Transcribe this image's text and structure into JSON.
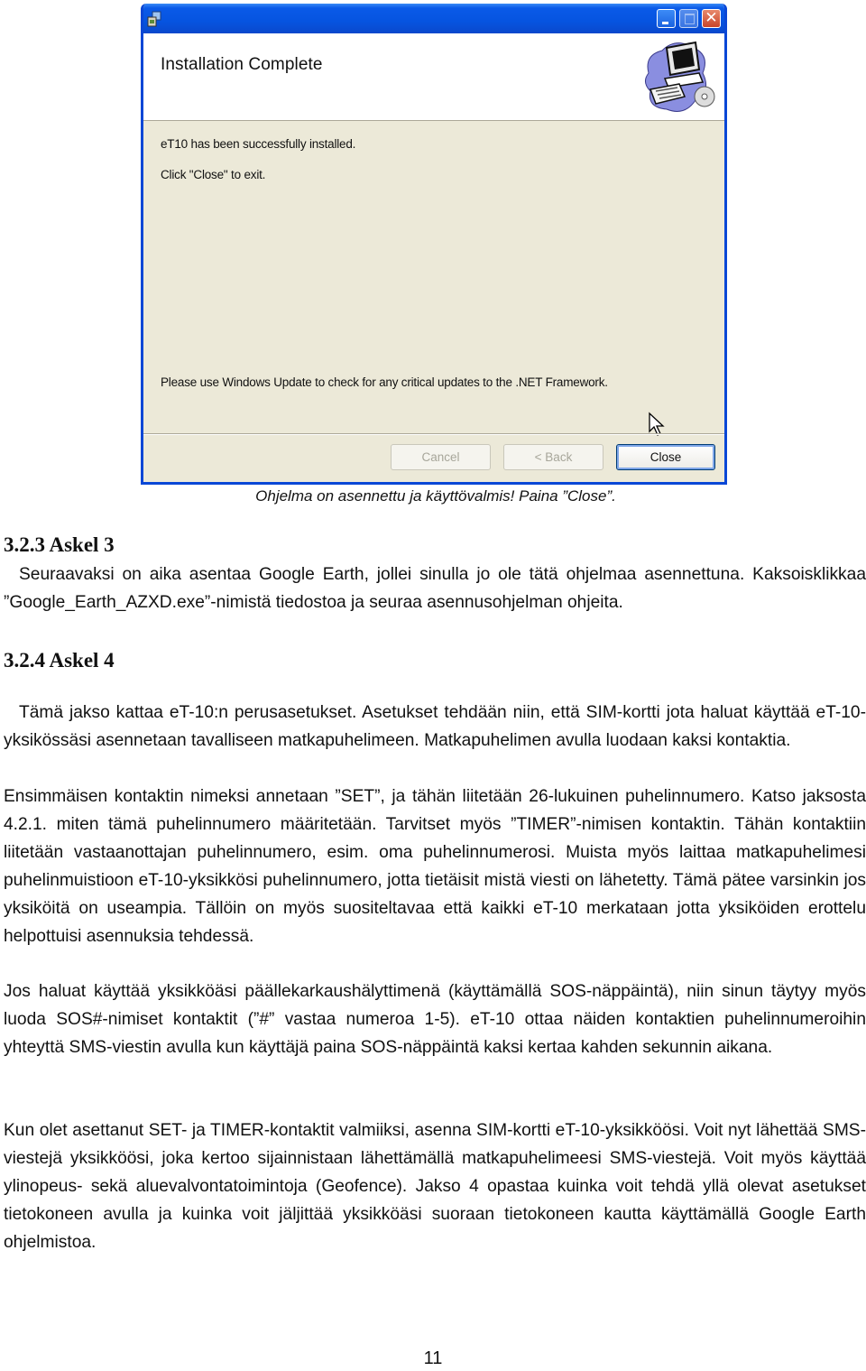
{
  "dialog": {
    "title_bar": {
      "app_icon": "installer-icon",
      "buttons": {
        "minimize": "minimize-icon",
        "maximize": "maximize-icon",
        "close": "close-icon",
        "close_glyph": "✕"
      }
    },
    "header_title": "Installation Complete",
    "header_art": "computer-cd-illustration",
    "message_installed": "eT10 has been successfully installed.",
    "message_click_close": "Click \"Close\" to exit.",
    "message_updates": "Please use Windows Update to check for any critical updates to the .NET Framework.",
    "buttons": {
      "cancel": "Cancel",
      "back": "< Back",
      "close": "Close"
    },
    "colors": {
      "titlebar": "#0654e0",
      "body": "#ece9d8",
      "close_button": "#c9452a"
    }
  },
  "caption": "Ohjelma on asennettu ja käyttövalmis! Paina ”Close”.",
  "sections": [
    {
      "heading": "3.2.3 Askel 3",
      "paragraphs": [
        "Seuraavaksi on aika asentaa Google Earth, jollei sinulla jo ole tätä ohjelmaa asennettuna. Kaksoisklikkaa ”Google_Earth_AZXD.exe”-nimistä tiedostoa ja seuraa asennusohjelman ohjeita."
      ]
    },
    {
      "heading": "3.2.4 Askel 4",
      "paragraphs": [
        "Tämä jakso kattaa eT-10:n perusasetukset. Asetukset tehdään niin, että SIM-kortti jota haluat käyttää eT-10-yksikössäsi asennetaan tavalliseen matkapuhelimeen. Matkapuhelimen avulla luodaan kaksi kontaktia.",
        "Ensimmäisen kontaktin nimeksi annetaan ”SET”, ja tähän liitetään 26-lukuinen puhelinnumero. Katso jaksosta 4.2.1. miten tämä puhelinnumero määritetään. Tarvitset myös ”TIMER”-nimisen kontaktin. Tähän kontaktiin liitetään vastaanottajan puhelinnumero, esim. oma puhelinnumerosi. Muista myös laittaa matkapuhelimesi puhelinmuistioon eT-10-yksikkösi puhelinnumero, jotta tietäisit mistä viesti on lähetetty. Tämä pätee varsinkin jos yksiköitä on useampia. Tällöin on myös suositeltavaa että kaikki eT-10 merkataan jotta yksiköiden erottelu helpottuisi asennuksia tehdessä.",
        "Jos haluat käyttää yksikköäsi päällekarkaushälyttimenä (käyttämällä SOS-näppäintä), niin sinun täytyy myös luoda SOS#-nimiset kontaktit (”#” vastaa numeroa 1-5). eT-10 ottaa näiden kontaktien puhelinnumeroihin yhteyttä SMS-viestin avulla kun käyttäjä paina SOS-näppäintä kaksi kertaa kahden sekunnin aikana.",
        "Kun olet asettanut SET- ja TIMER-kontaktit valmiiksi, asenna SIM-kortti eT-10-yksikköösi. Voit nyt lähettää SMS-viestejä yksikköösi, joka kertoo sijainnistaan lähettämällä matkapuhelimeesi SMS-viestejä. Voit myös käyttää ylinopeus- sekä aluevalvontatoimintoja (Geofence). Jakso 4 opastaa kuinka voit tehdä yllä olevat asetukset tietokoneen avulla ja kuinka voit jäljittää yksikköäsi suoraan tietokoneen kautta käyttämällä Google Earth ohjelmistoa."
      ]
    }
  ],
  "page_number": "11"
}
